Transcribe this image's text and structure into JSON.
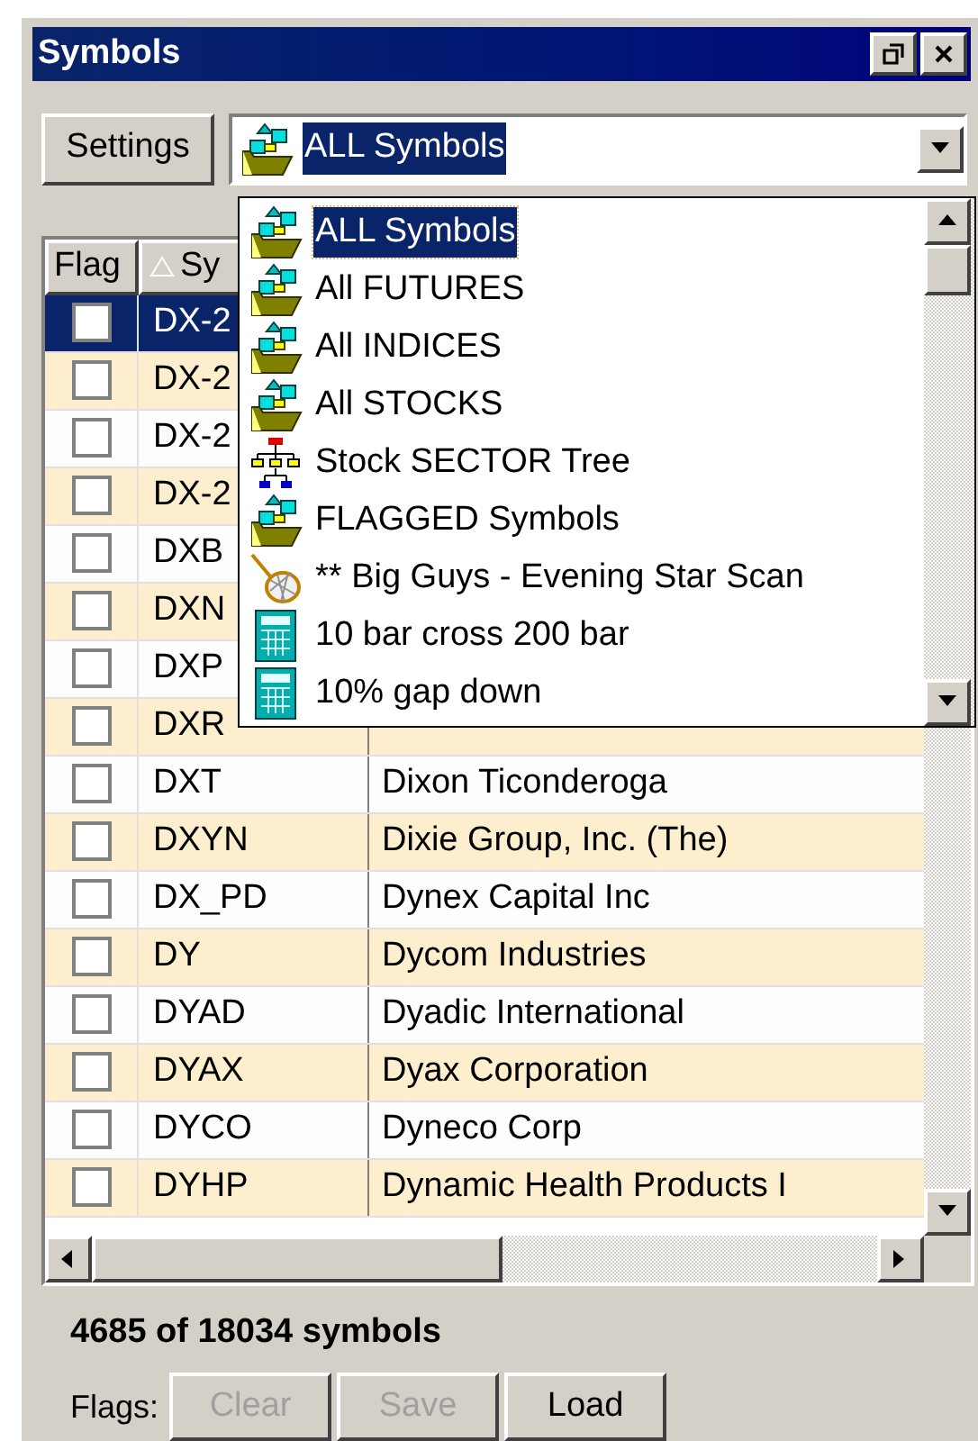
{
  "window": {
    "title": "Symbols"
  },
  "settings_button": "Settings",
  "symbol_set": {
    "value": "ALL Symbols",
    "kind": "folder",
    "expanded": true
  },
  "dropdown_items": [
    {
      "label": "ALL Symbols",
      "kind": "folder",
      "selected": true
    },
    {
      "label": "All FUTURES",
      "kind": "folder",
      "selected": false
    },
    {
      "label": "All INDICES",
      "kind": "folder",
      "selected": false
    },
    {
      "label": "All STOCKS",
      "kind": "folder",
      "selected": false
    },
    {
      "label": "Stock SECTOR Tree",
      "kind": "tree",
      "selected": false
    },
    {
      "label": "FLAGGED Symbols",
      "kind": "folder",
      "selected": false
    },
    {
      "label": "** Big Guys - Evening Star Scan",
      "kind": "net",
      "selected": false
    },
    {
      "label": "10 bar cross 200 bar",
      "kind": "calculator",
      "selected": false
    },
    {
      "label": "10% gap down",
      "kind": "calculator",
      "selected": false
    }
  ],
  "table": {
    "columns": [
      "Flag",
      "Sy"
    ],
    "rows": [
      {
        "checked": false,
        "selected": true,
        "symbol": "DX-2"
      },
      {
        "checked": false,
        "selected": false,
        "symbol": "DX-2"
      },
      {
        "checked": false,
        "selected": false,
        "symbol": "DX-2"
      },
      {
        "checked": false,
        "selected": false,
        "symbol": "DX-2"
      },
      {
        "checked": false,
        "selected": false,
        "symbol": "DXB"
      },
      {
        "checked": false,
        "selected": false,
        "symbol": "DXN"
      },
      {
        "checked": false,
        "selected": false,
        "symbol": "DXP"
      },
      {
        "checked": false,
        "selected": false,
        "symbol": "DXR"
      },
      {
        "checked": false,
        "selected": false,
        "symbol": "DXT",
        "name": "Dixon Ticonderoga"
      },
      {
        "checked": false,
        "selected": false,
        "symbol": "DXYN",
        "name": "Dixie Group, Inc. (The)"
      },
      {
        "checked": false,
        "selected": false,
        "symbol": "DX_PD",
        "name": "Dynex Capital Inc"
      },
      {
        "checked": false,
        "selected": false,
        "symbol": "DY",
        "name": "Dycom Industries"
      },
      {
        "checked": false,
        "selected": false,
        "symbol": "DYAD",
        "name": "Dyadic International"
      },
      {
        "checked": false,
        "selected": false,
        "symbol": "DYAX",
        "name": "Dyax Corporation"
      },
      {
        "checked": false,
        "selected": false,
        "symbol": "DYCO",
        "name": "Dyneco Corp"
      },
      {
        "checked": false,
        "selected": false,
        "symbol": "DYHP",
        "name": "Dynamic Health Products I"
      }
    ]
  },
  "status": "4685 of 18034 symbols",
  "flags": {
    "label": "Flags:",
    "buttons": [
      {
        "label": "Clear",
        "disabled": true
      },
      {
        "label": "Save",
        "disabled": true
      },
      {
        "label": "Load",
        "disabled": false
      }
    ]
  }
}
